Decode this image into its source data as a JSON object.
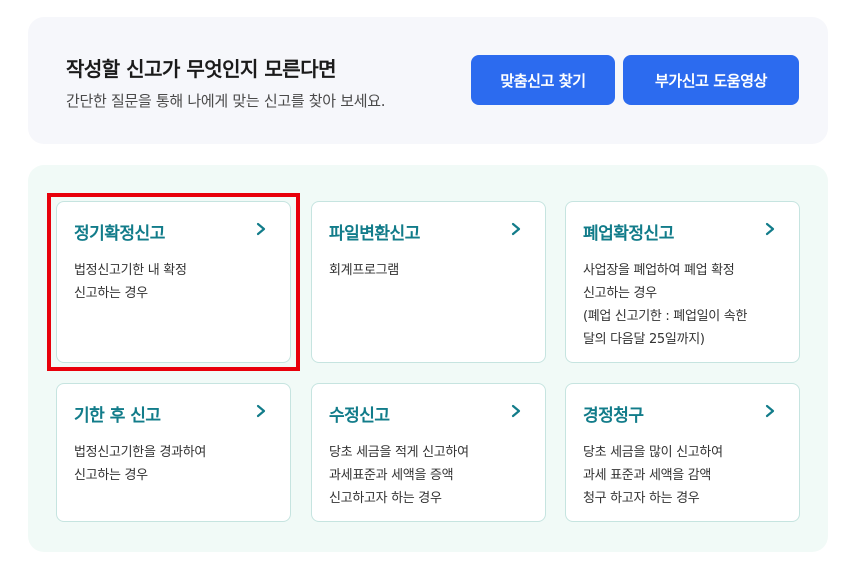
{
  "banner": {
    "title": "작성할 신고가 무엇인지 모른다면",
    "subtitle": "간단한 질문을 통해 나에게 맞는 신고를 찾아 보세요.",
    "find_button": "맞춤신고 찾기",
    "video_button": "부가신고 도움영상"
  },
  "cards": [
    {
      "title": "정기확정신고",
      "lines": [
        "법정신고기한 내 확정",
        "신고하는 경우"
      ]
    },
    {
      "title": "파일변환신고",
      "lines": [
        "회계프로그램"
      ]
    },
    {
      "title": "폐업확정신고",
      "lines": [
        "사업장을 폐업하여 폐업 확정",
        "신고하는 경우",
        "(폐업 신고기한 : 폐업일이 속한",
        "달의 다음달 25일까지)"
      ]
    },
    {
      "title": "기한 후 신고",
      "lines": [
        "법정신고기한을 경과하여",
        "신고하는 경우"
      ]
    },
    {
      "title": "수정신고",
      "lines": [
        "당초 세금을 적게 신고하여",
        "과세표준과 세액을 증액",
        "신고하고자 하는 경우"
      ]
    },
    {
      "title": "경정청구",
      "lines": [
        "당초 세금을 많이 신고하여",
        "과세 표준과 세액을 감액",
        "청구 하고자 하는 경우"
      ]
    }
  ],
  "colors": {
    "accent_blue": "#2c6bef",
    "card_title_teal": "#127c8a",
    "highlight_red": "#e8000b"
  },
  "icons": {
    "card_arrow": "chevron-right-icon"
  }
}
